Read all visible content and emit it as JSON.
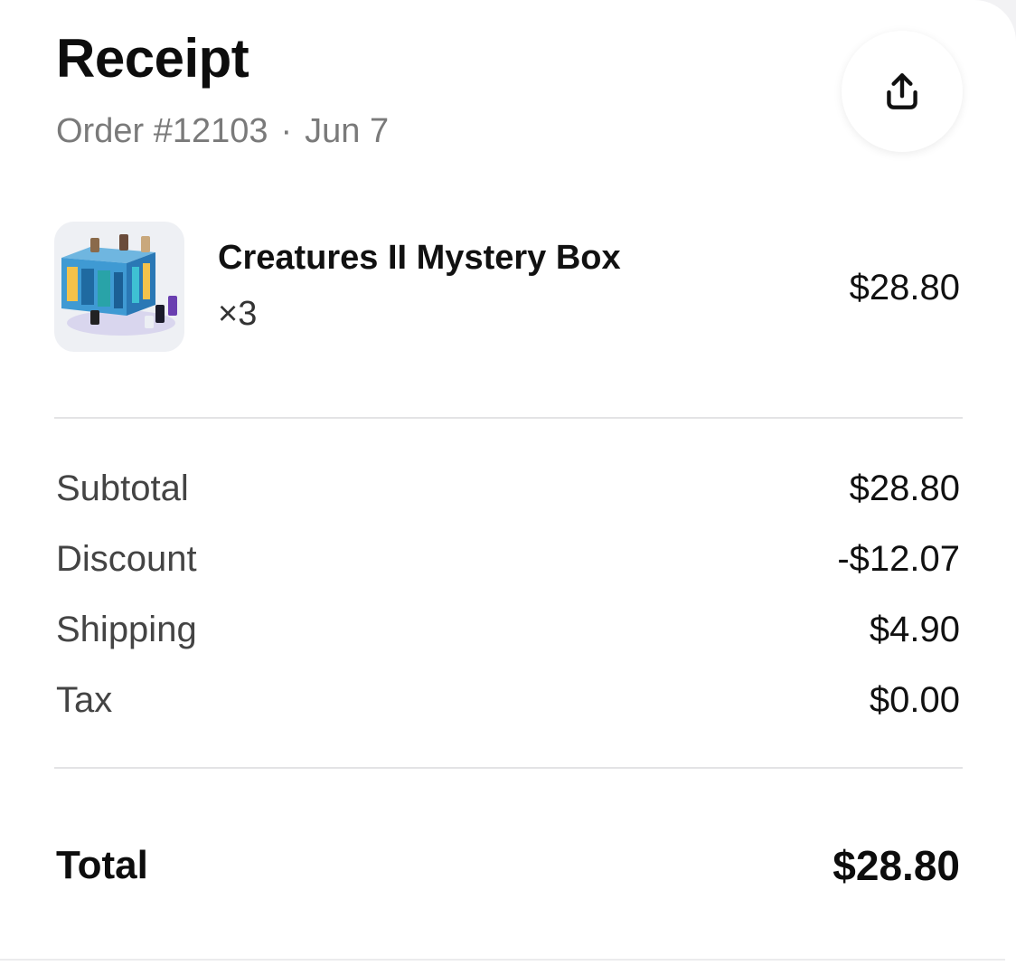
{
  "header": {
    "title": "Receipt",
    "order_number": "Order #12103",
    "separator": "·",
    "date": "Jun 7"
  },
  "share_button": {
    "icon": "share-icon"
  },
  "item": {
    "name": "Creatures II Mystery Box",
    "quantity": "×3",
    "price": "$28.80",
    "thumbnail_icon": "product-thumbnail"
  },
  "summary": {
    "subtotal_label": "Subtotal",
    "subtotal_value": "$28.80",
    "discount_label": "Discount",
    "discount_value": "-$12.07",
    "shipping_label": "Shipping",
    "shipping_value": "$4.90",
    "tax_label": "Tax",
    "tax_value": "$0.00"
  },
  "total": {
    "label": "Total",
    "value": "$28.80"
  }
}
